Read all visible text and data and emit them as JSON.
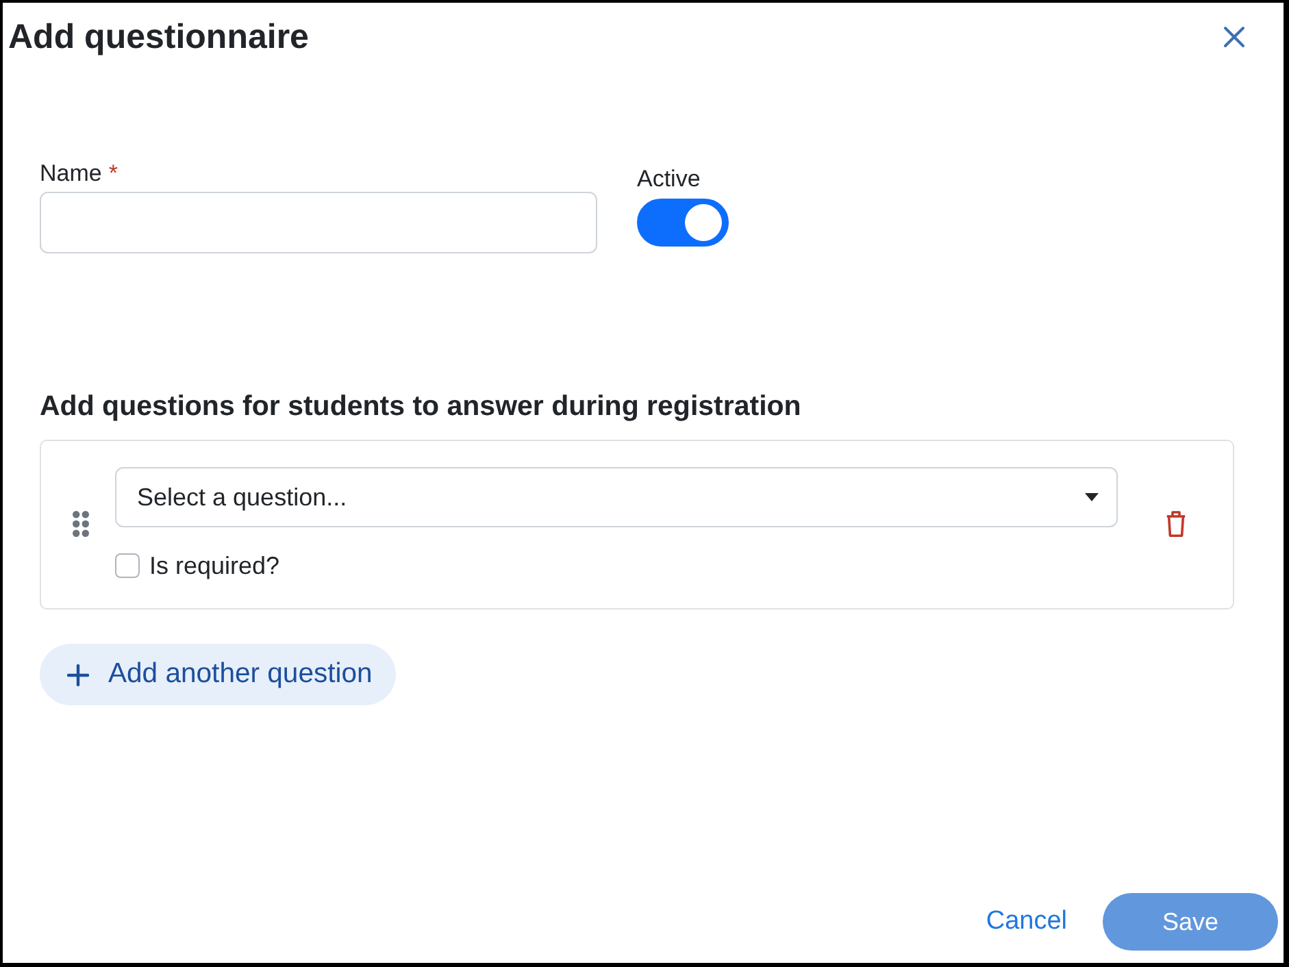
{
  "dialog": {
    "title": "Add questionnaire"
  },
  "name_field": {
    "label": "Name",
    "required_mark": "*"
  },
  "active": {
    "label": "Active",
    "on": true
  },
  "questions_section": {
    "heading": "Add questions for students to answer during registration",
    "questions": [
      {
        "placeholder": "Select a question...",
        "required_label": "Is required?",
        "required": false
      }
    ],
    "add_button": "Add another question"
  },
  "footer": {
    "buttons": [
      {
        "label": "Cancel",
        "kind": "link",
        "disabled": false
      },
      {
        "label": "Save",
        "kind": "primary",
        "disabled": true
      }
    ]
  }
}
